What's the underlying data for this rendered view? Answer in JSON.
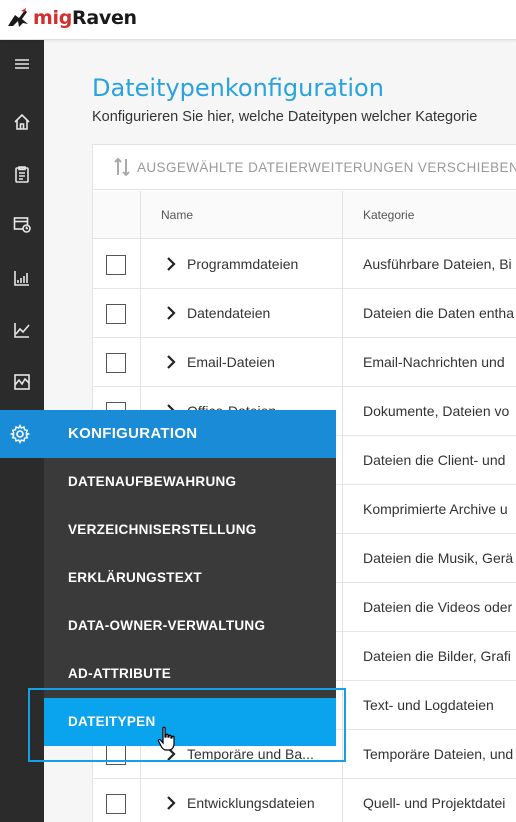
{
  "header": {
    "logo_mig": "mig",
    "logo_raven": "Raven"
  },
  "rail": {
    "icons": [
      "menu-icon",
      "home-icon",
      "clipboard-icon",
      "calendar-clock-icon",
      "bar-chart-icon",
      "line-chart-icon",
      "activity-chart-icon",
      "gear-icon"
    ]
  },
  "page": {
    "title": "Dateitypenkonfiguration",
    "subtitle": "Konfigurieren Sie hier, welche Dateitypen welcher Kategorie"
  },
  "toolbar": {
    "move_label": "AUSGEWÄHLTE DATEIERWEITERUNGEN VERSCHIEBEN"
  },
  "table": {
    "headers": {
      "name": "Name",
      "category": "Kategorie"
    },
    "rows": [
      {
        "name": "Programmdateien",
        "category": "Ausführbare Dateien, Bi"
      },
      {
        "name": "Datendateien",
        "category": "Dateien die Daten entha"
      },
      {
        "name": "Email-Dateien",
        "category": "Email-Nachrichten und"
      },
      {
        "name": "Office-Dateien",
        "category": "Dokumente, Dateien vo"
      },
      {
        "name": "",
        "category": "Dateien die Client- und"
      },
      {
        "name": "",
        "category": "Komprimierte Archive u"
      },
      {
        "name": "",
        "category": "Dateien die Musik, Gerä"
      },
      {
        "name": "",
        "category": "Dateien die Videos oder"
      },
      {
        "name": "",
        "category": "Dateien die Bilder, Grafi"
      },
      {
        "name": "",
        "category": "Text- und Logdateien"
      },
      {
        "name": "Temporäre und Ba...",
        "category": "Temporäre Dateien, und"
      },
      {
        "name": "Entwicklungsdateien",
        "category": "Quell- und Projektdatei"
      }
    ]
  },
  "flyout": {
    "header": "KONFIGURATION",
    "items": [
      {
        "label": "DATENAUFBEWAHRUNG"
      },
      {
        "label": "VERZEICHNISERSTELLUNG"
      },
      {
        "label": "ERKLÄRUNGSTEXT"
      },
      {
        "label": "DATA-OWNER-VERWALTUNG"
      },
      {
        "label": "AD-ATTRIBUTE"
      },
      {
        "label": "DATEITYPEN"
      }
    ],
    "active_item": "DATEITYPEN"
  },
  "colors": {
    "accent": "#29a3dd",
    "flyout_header": "#1a8bd6",
    "flyout_active": "#0aa3ee",
    "rail": "#2b2b2b",
    "flyout_bg": "#3a3a3a",
    "logo_red": "#d32f2f"
  }
}
